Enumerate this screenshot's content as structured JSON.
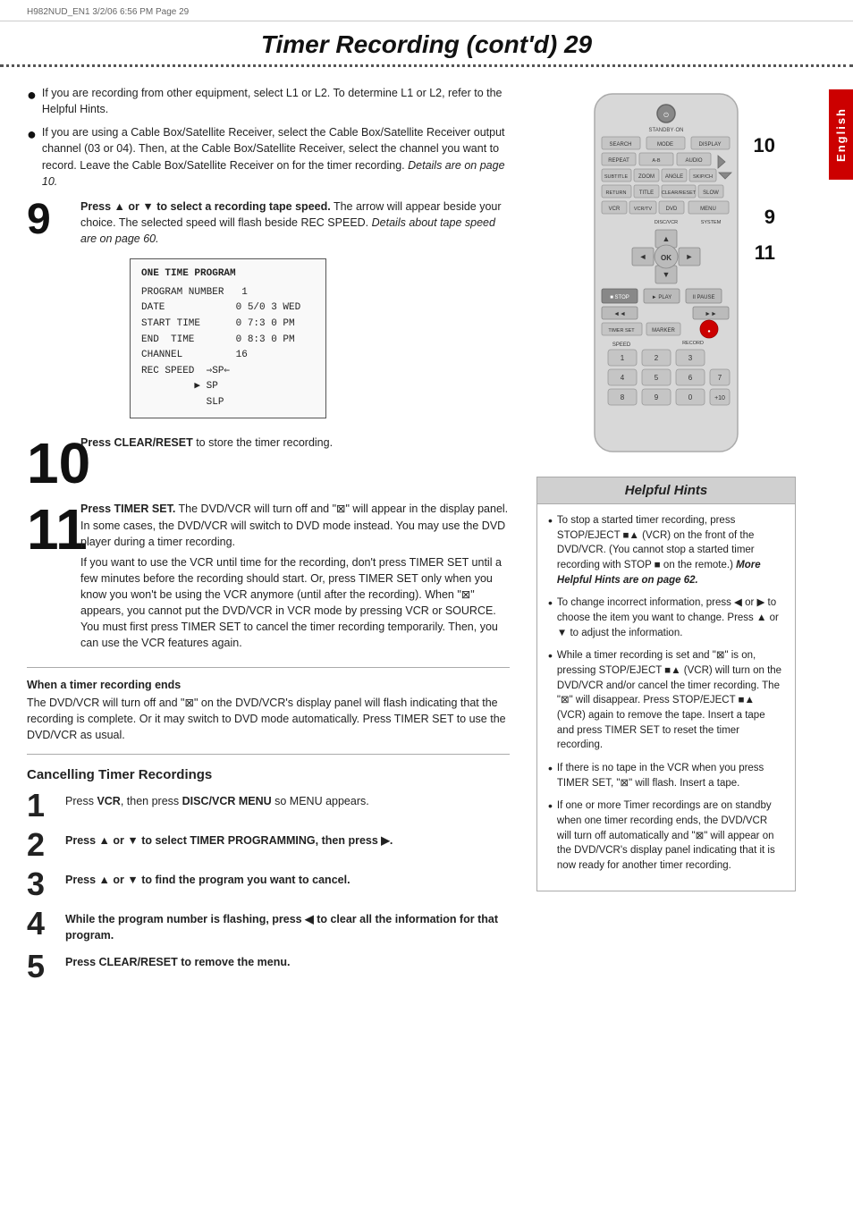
{
  "header": {
    "text": "H982NUD_EN1  3/2/06  6:56 PM  Page 29"
  },
  "page": {
    "title": "Timer Recording (cont'd)  29"
  },
  "english_tab": "English",
  "bullets": [
    {
      "text": "If you are recording from other equipment, select L1 or L2. To determine L1 or L2, refer to the Helpful Hints."
    },
    {
      "text": "If you are using a Cable Box/Satellite Receiver, select the Cable Box/Satellite Receiver output channel (03 or 04). Then, at the Cable Box/Satellite Receiver, select the channel you want to record. Leave the Cable Box/Satellite Receiver on for the timer recording. Details are on page 10."
    }
  ],
  "steps": {
    "step9": {
      "number": "9",
      "bold_text": "Press ▲ or ▼ to select a recording tape speed.",
      "text": " The arrow will appear beside your choice. The selected speed will flash beside REC SPEED. Details about tape speed are on page 60."
    },
    "step10": {
      "number": "10",
      "bold_text": "Press CLEAR/RESET",
      "text": " to store the timer recording."
    },
    "step11": {
      "number": "11",
      "bold_text": "Press TIMER SET.",
      "text": " The DVD/VCR will turn off and \"⊠\" will appear in the display panel. In some cases, the DVD/VCR will switch to DVD mode instead. You may use the DVD player during a timer recording.",
      "extra_text": "If you want to use the VCR until time for the recording, don't press TIMER SET until a few minutes before the recording should start. Or, press TIMER SET only when you know you won't be using the VCR anymore (until after the recording). When \"⊠\" appears, you cannot put the DVD/VCR in VCR mode by pressing VCR or SOURCE. You must first press TIMER SET to cancel the timer recording temporarily. Then, you can use the VCR features again."
    }
  },
  "osd": {
    "title": "ONE TIME PROGRAM",
    "rows": [
      {
        "label": "PROGRAM NUMBER",
        "value": "1"
      },
      {
        "label": "DATE",
        "value": "0 5 / 0 3  WED"
      },
      {
        "label": "START TIME",
        "value": "0 7 : 3 0  P M"
      },
      {
        "label": "END TIME",
        "value": "0 8 : 3 0  P M"
      },
      {
        "label": "CHANNEL",
        "value": "16"
      },
      {
        "label": "REC SPEED",
        "value": "⇒ S P ⇐"
      },
      {
        "label": "",
        "value": "▶  SP"
      },
      {
        "label": "",
        "value": "    SLP"
      }
    ]
  },
  "when_ends": {
    "heading": "When a timer recording ends",
    "text": "The DVD/VCR will turn off and \"⊠\" on the DVD/VCR's display panel will flash indicating that the recording is complete. Or it may switch to DVD mode automatically. Press TIMER SET to use the DVD/VCR as usual."
  },
  "cancelling": {
    "heading": "Cancelling Timer Recordings",
    "steps": [
      {
        "number": "1",
        "text": "Press VCR, then press DISC/VCR MENU so MENU appears."
      },
      {
        "number": "2",
        "bold": "Press ▲ or ▼ to select TIMER PROGRAMMING, then press ▶."
      },
      {
        "number": "3",
        "bold": "Press ▲ or ▼ to find the program you want to cancel."
      },
      {
        "number": "4",
        "bold": "While the program number is flashing, press ◀ to clear all the information for that program."
      },
      {
        "number": "5",
        "bold": "Press CLEAR/RESET to remove the menu."
      }
    ]
  },
  "helpful_hints": {
    "title": "Helpful Hints",
    "hints": [
      "To stop a started timer recording, press STOP/EJECT ■▲ (VCR) on the front of the DVD/VCR. (You cannot stop a started timer recording with STOP ■ on the remote.) More Helpful Hints are on page 62.",
      "To change incorrect information, press ◀ or ▶ to choose the item you want to change. Press ▲ or ▼ to adjust the information.",
      "While a timer recording is set and \"⊠\" is on, pressing STOP/EJECT ■▲ (VCR) will turn on the DVD/VCR and/or cancel the timer recording. The \"⊠\" will disappear. Press STOP/EJECT ■▲ (VCR) again to remove the tape. Insert a tape and press TIMER SET to reset the timer recording.",
      "If there is no tape in the VCR when you press TIMER SET, \"⊠\" will flash. Insert a tape.",
      "If one or more Timer recordings are on standby when one timer recording ends, the DVD/VCR will turn off automatically and \"⊠\" will appear on the DVD/VCR's display panel indicating that it is now ready for another timer recording."
    ]
  },
  "remote": {
    "buttons": {
      "standby": "STANDBY·ON",
      "search": "SEARCH",
      "mode": "MODE",
      "display": "DISPLAY",
      "repeat1": "REPEAT",
      "repeat2": "REPEAT",
      "audio": "AUDIO",
      "play_fwd": "►",
      "subtitle": "SUBTITLE",
      "zoom": "ZOOM",
      "angle": "ANGLE",
      "skip": "SKIP/CH",
      "play_rev": "◄",
      "play_dn": "▼",
      "return": "RETURN",
      "title": "TITLE",
      "clear_reset": "CLEAR/RESET",
      "slow": "SLOW",
      "vcr": "VCR",
      "vcr_tv": "VCR/TV",
      "dvd": "DVD",
      "disc_vcr": "DISC/VCR",
      "system": "SYSTEM",
      "menu": "MENU",
      "ok": "OK",
      "stop": "STOP",
      "play": "PLAY",
      "pause": "PAUSE",
      "rew": "◄◄",
      "ff": "►►",
      "timer_set": "TIMER SET",
      "marker": "MARKER",
      "record": "RECORD",
      "speed": "SPEED",
      "nums": [
        "1",
        "2",
        "3",
        "4",
        "5",
        "6",
        "7",
        "8",
        "9",
        "0",
        "+10"
      ]
    },
    "markers": {
      "m10": "10",
      "m9": "9",
      "m11": "11"
    }
  }
}
